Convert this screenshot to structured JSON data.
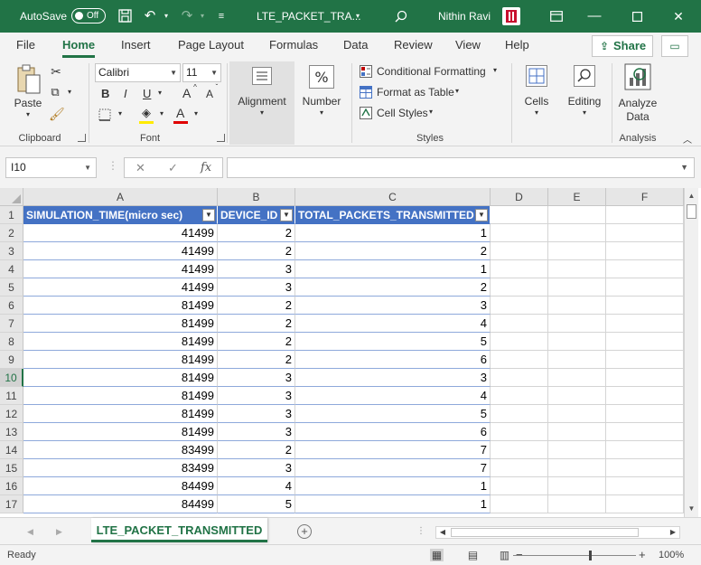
{
  "titlebar": {
    "autosave_label": "AutoSave",
    "autosave_state": "Off",
    "filename": "LTE_PACKET_TRA...",
    "user_name": "Nithin Ravi",
    "icons": [
      "save-icon",
      "undo-icon",
      "redo-icon",
      "customize-icon",
      "search-icon",
      "minimize-icon",
      "restore-icon",
      "close-icon"
    ]
  },
  "ribbon_tabs": [
    "File",
    "Home",
    "Insert",
    "Page Layout",
    "Formulas",
    "Data",
    "Review",
    "View",
    "Help"
  ],
  "active_tab": "Home",
  "share_label": "Share",
  "ribbon": {
    "clipboard": {
      "paste": "Paste",
      "label": "Clipboard"
    },
    "font": {
      "name": "Calibri",
      "size": "11",
      "bold": "B",
      "italic": "I",
      "underline": "U",
      "grow": "A",
      "shrink": "A",
      "color_a": "A",
      "label": "Font"
    },
    "alignment": "Alignment",
    "number": "Number",
    "styles": {
      "conditional": "Conditional Formatting",
      "format_table": "Format as Table",
      "cell_styles": "Cell Styles",
      "label": "Styles"
    },
    "cells": "Cells",
    "editing": "Editing",
    "analyze": {
      "line1": "Analyze",
      "line2": "Data",
      "label": "Analysis"
    }
  },
  "formula_bar": {
    "name_box": "I10",
    "fx": "fx",
    "formula": ""
  },
  "grid": {
    "columns": [
      "A",
      "B",
      "C",
      "D",
      "E",
      "F"
    ],
    "rows": [
      "1",
      "2",
      "3",
      "4",
      "5",
      "6",
      "7",
      "8",
      "9",
      "10",
      "11",
      "12",
      "13",
      "14",
      "15",
      "16",
      "17"
    ],
    "selected_row": "10",
    "headers": [
      "SIMULATION_TIME(micro sec)",
      "DEVICE_ID",
      "TOTAL_PACKETS_TRANSMITTED"
    ],
    "data": [
      [
        "41499",
        "2",
        "1"
      ],
      [
        "41499",
        "2",
        "2"
      ],
      [
        "41499",
        "3",
        "1"
      ],
      [
        "41499",
        "3",
        "2"
      ],
      [
        "81499",
        "2",
        "3"
      ],
      [
        "81499",
        "2",
        "4"
      ],
      [
        "81499",
        "2",
        "5"
      ],
      [
        "81499",
        "2",
        "6"
      ],
      [
        "81499",
        "3",
        "3"
      ],
      [
        "81499",
        "3",
        "4"
      ],
      [
        "81499",
        "3",
        "5"
      ],
      [
        "81499",
        "3",
        "6"
      ],
      [
        "83499",
        "2",
        "7"
      ],
      [
        "83499",
        "3",
        "7"
      ],
      [
        "84499",
        "4",
        "1"
      ],
      [
        "84499",
        "5",
        "1"
      ]
    ]
  },
  "sheet_tab": "LTE_PACKET_TRANSMITTED",
  "status": {
    "text": "Ready",
    "zoom_minus": "−",
    "zoom_plus": "+",
    "zoom": "100%"
  },
  "colors": {
    "accent": "#217346",
    "table_header": "#4472c4",
    "table_border": "#8ea9db"
  }
}
